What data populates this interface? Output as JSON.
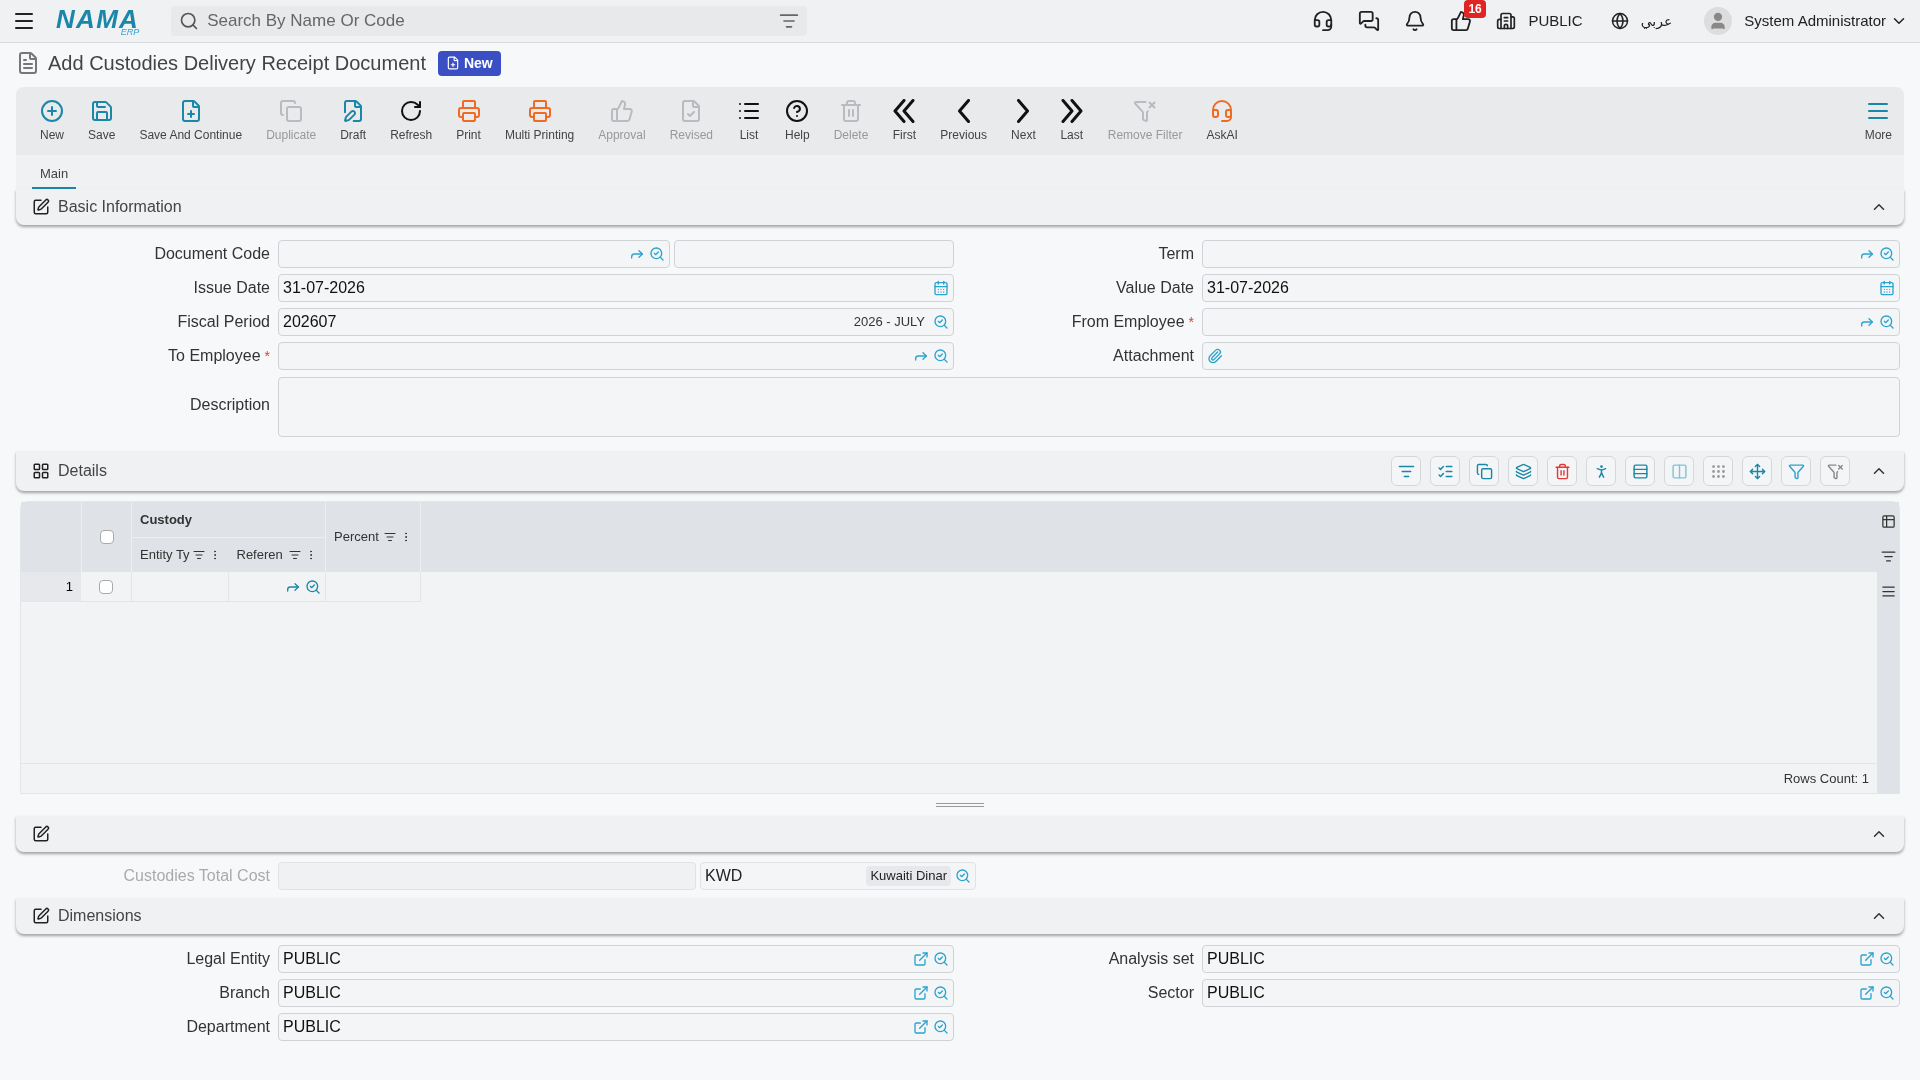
{
  "top_bar": {
    "logo": {
      "name": "NAMA",
      "sub": "ERP"
    },
    "search": {
      "placeholder": "Search By Name Or Code"
    },
    "notification_count": "16",
    "company": "PUBLIC",
    "language": "عربي",
    "user": "System Administrator"
  },
  "page": {
    "title": "Add Custodies Delivery Receipt Document",
    "status_badge": "New"
  },
  "toolbar": [
    {
      "label": "New",
      "kind": "action",
      "disabled": false
    },
    {
      "label": "Save",
      "kind": "action",
      "disabled": false
    },
    {
      "label": "Save And Continue",
      "kind": "action",
      "disabled": false
    },
    {
      "label": "Duplicate",
      "disabled": true
    },
    {
      "label": "Draft",
      "kind": "action",
      "disabled": false
    },
    {
      "label": "Refresh",
      "kind": "plain",
      "disabled": false
    },
    {
      "label": "Print",
      "kind": "print",
      "disabled": false
    },
    {
      "label": "Multi Printing",
      "kind": "print",
      "disabled": false
    },
    {
      "label": "Approval",
      "disabled": true
    },
    {
      "label": "Revised",
      "disabled": true
    },
    {
      "label": "List",
      "kind": "plain",
      "disabled": false
    },
    {
      "label": "Help",
      "kind": "plain",
      "disabled": false
    },
    {
      "label": "Delete",
      "disabled": true
    },
    {
      "label": "First",
      "kind": "plain",
      "disabled": false
    },
    {
      "label": "Previous",
      "kind": "plain",
      "disabled": false
    },
    {
      "label": "Next",
      "kind": "plain",
      "disabled": false
    },
    {
      "label": "Last",
      "kind": "plain",
      "disabled": false
    },
    {
      "label": "Remove Filter",
      "disabled": true
    },
    {
      "label": "AskAI",
      "kind": "print",
      "disabled": false
    }
  ],
  "more_button": "More",
  "tabs": [
    {
      "label": "Main",
      "selected": true
    }
  ],
  "basic_information": {
    "title": "Basic Information",
    "expanded": true,
    "left_fields": [
      {
        "label": "Document Code",
        "kind": "code"
      },
      {
        "label": "Issue Date",
        "value": "31-07-2026",
        "kind": "date"
      },
      {
        "label": "Fiscal Period",
        "value": "202607",
        "extra": "2026 - JULY",
        "kind": "search"
      },
      {
        "label": "To Employee",
        "kind": "lookup",
        "required_mark": "*"
      }
    ],
    "right_fields": [
      {
        "label": "Term",
        "kind": "lookup"
      },
      {
        "label": "Value Date",
        "value": "31-07-2026",
        "kind": "date"
      },
      {
        "label": "From Employee",
        "kind": "lookup",
        "required_mark": "*"
      },
      {
        "label": "Attachment",
        "kind": "attachment"
      }
    ],
    "description": {
      "label": "Description"
    }
  },
  "details": {
    "title": "Details",
    "expanded": true,
    "table": {
      "all_checked": false,
      "group_header": "Custody",
      "columns": [
        "Entity Ty",
        "Referen",
        "Percent"
      ],
      "rows": [
        {
          "number": "1",
          "checked": false
        }
      ]
    },
    "rows_count": "Rows Count: 1"
  },
  "totals": {
    "expanded": true,
    "label": "Custodies Total Cost",
    "currency_code": "KWD",
    "currency_name": "Kuwaiti Dinar"
  },
  "dimensions": {
    "title": "Dimensions",
    "expanded": true,
    "left_fields": [
      {
        "label": "Legal Entity",
        "value": "PUBLIC"
      },
      {
        "label": "Branch",
        "value": "PUBLIC"
      },
      {
        "label": "Department",
        "value": "PUBLIC"
      }
    ],
    "right_fields": [
      {
        "label": "Analysis set",
        "value": "PUBLIC"
      },
      {
        "label": "Sector",
        "value": "PUBLIC"
      }
    ]
  }
}
